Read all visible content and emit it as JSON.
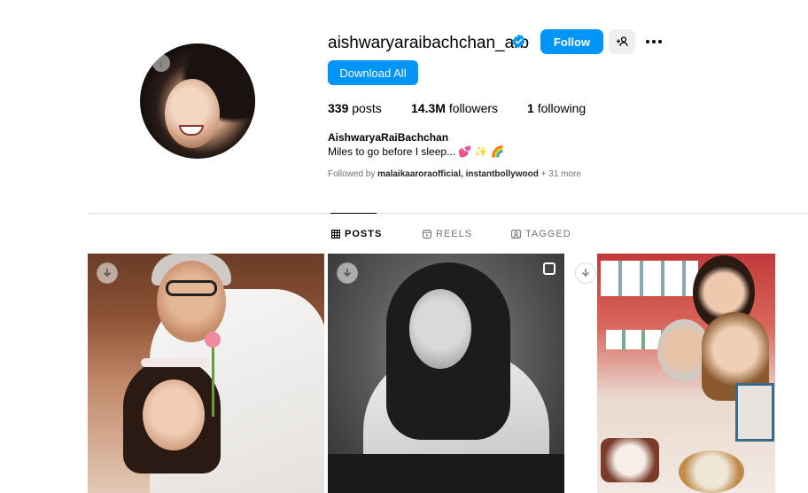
{
  "profile": {
    "username": "aishwaryaraibachchan_arb",
    "follow_label": "Follow",
    "download_all_label": "Download All",
    "stats": {
      "posts_count": "339",
      "posts_label": "posts",
      "followers_count": "14.3M",
      "followers_label": "followers",
      "following_count": "1",
      "following_label": "following"
    },
    "full_name": "AishwaryaRaiBachchan",
    "bio": "Miles to go before I sleep... 💕 ✨ 🌈",
    "followed_by_prefix": "Followed by",
    "followed_by_users": "malaikaaroraofficial, instantbollywood",
    "followed_by_more": "+ 31 more"
  },
  "tabs": [
    {
      "label": "POSTS",
      "icon": "grid-icon",
      "active": true
    },
    {
      "label": "REELS",
      "icon": "reels-icon",
      "active": false
    },
    {
      "label": "TAGGED",
      "icon": "tagged-icon",
      "active": false
    }
  ],
  "colors": {
    "accent": "#0095f6",
    "secondary_button": "#efefef",
    "muted_text": "#737373",
    "divider": "#dbdbdb"
  }
}
